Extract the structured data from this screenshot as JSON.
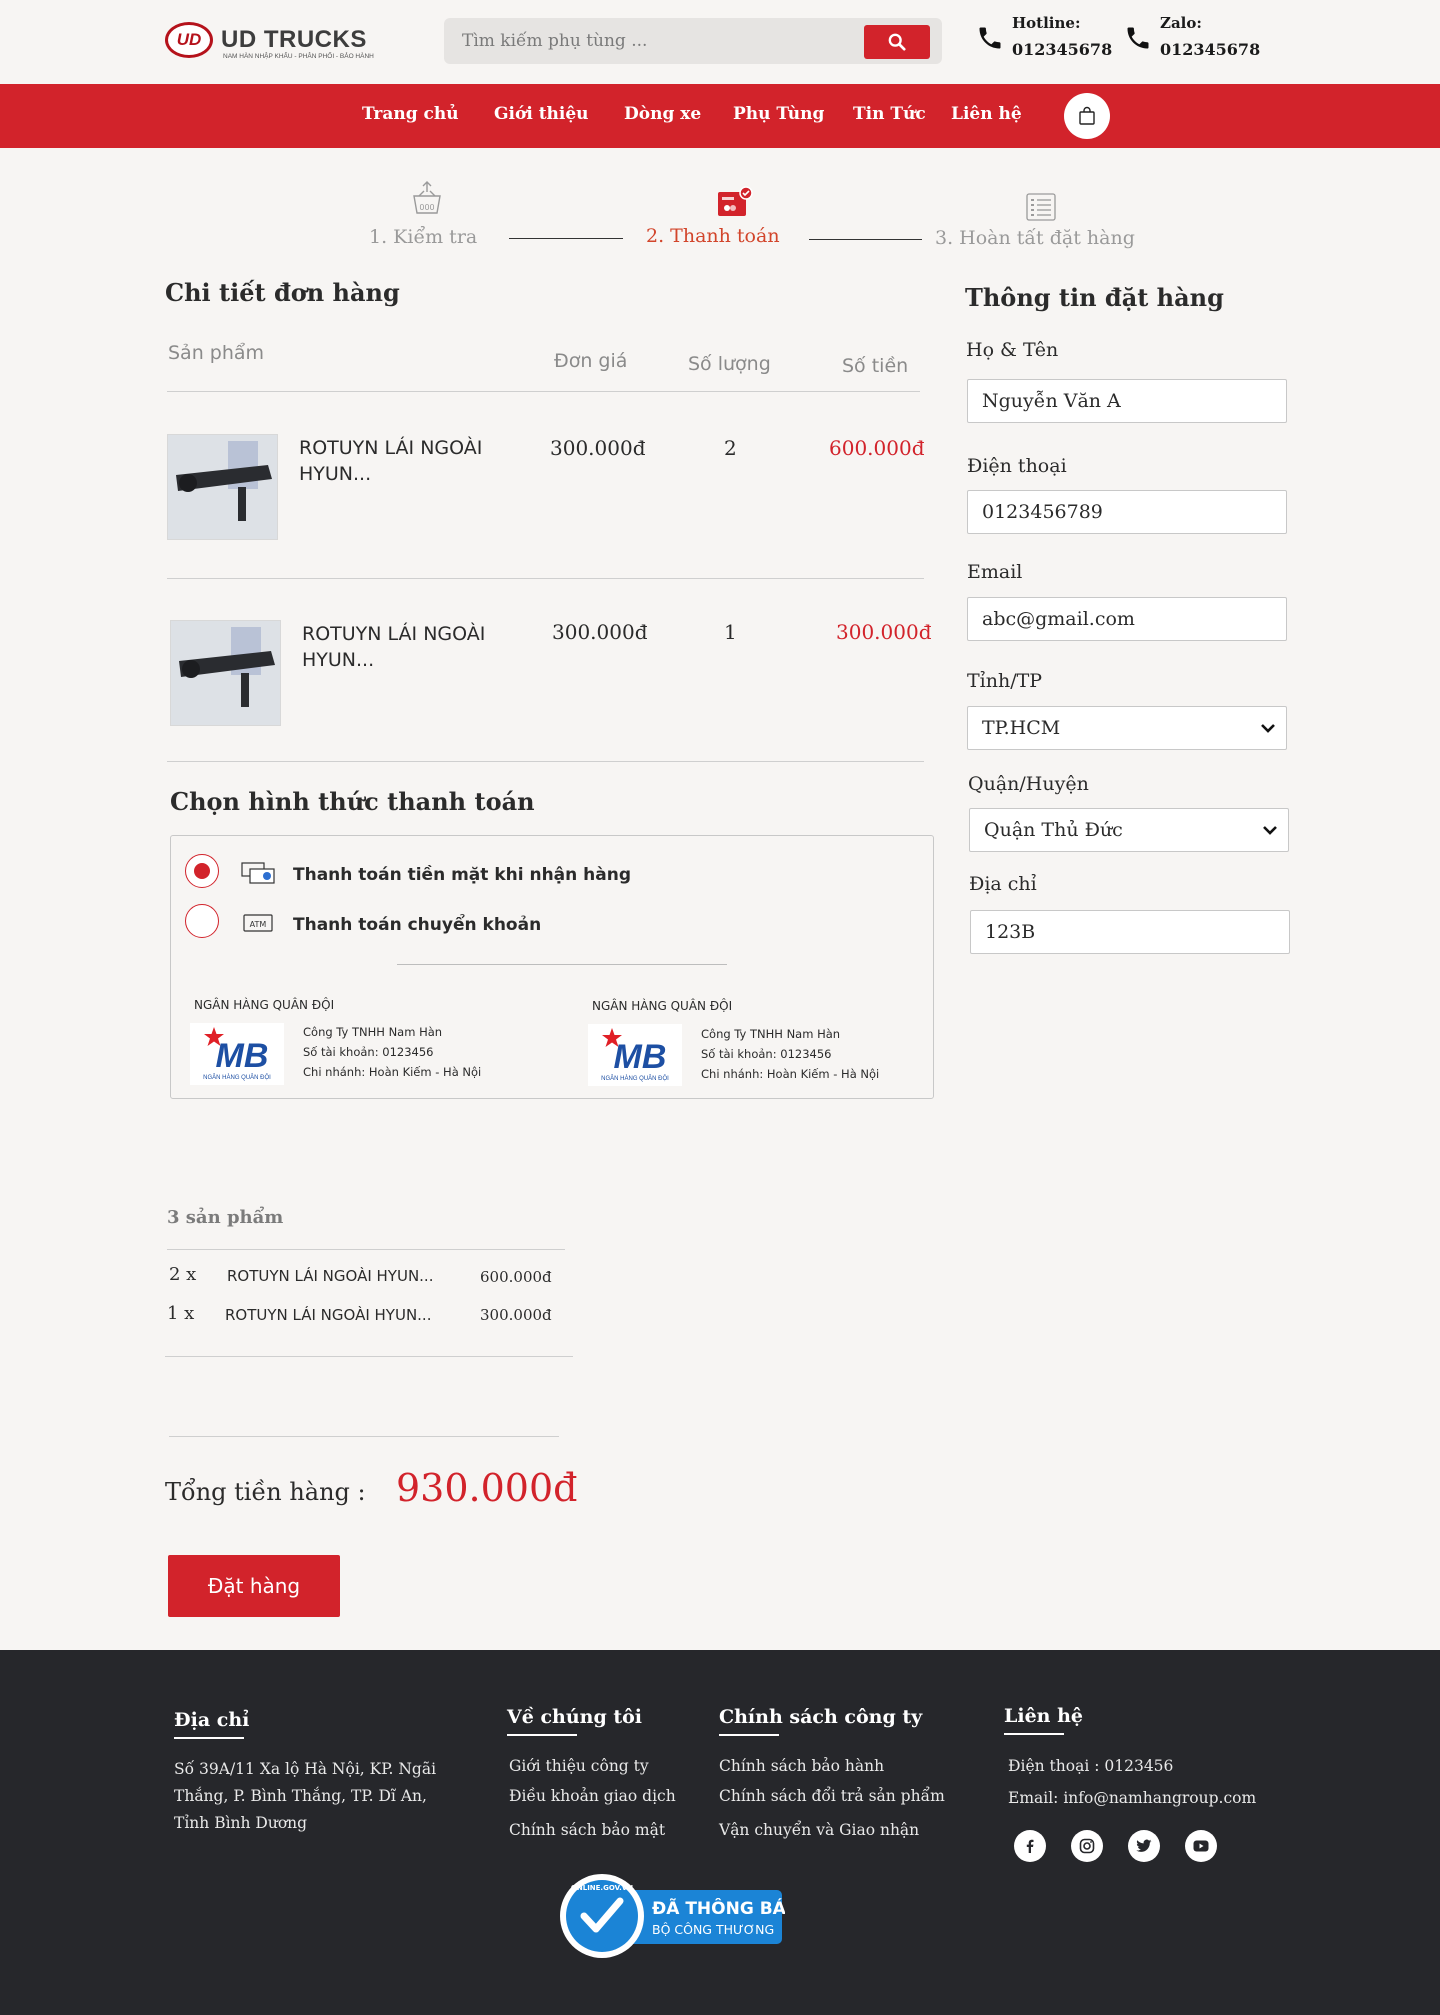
{
  "header": {
    "brand": "UD TRUCKS",
    "brand_badge": "UD",
    "brand_tagline": "NAM HÀN NHẬP KHẨU - PHÂN PHỐI - BẢO HÀNH",
    "search_placeholder": "Tìm kiếm phụ tùng ...",
    "hotline_label": "Hotline:",
    "hotline_value": "012345678",
    "zalo_label": "Zalo:",
    "zalo_value": "012345678"
  },
  "nav": {
    "items": [
      "Trang chủ",
      "Giới thiệu",
      "Dòng xe",
      "Phụ Tùng",
      "Tin Tức",
      "Liên hệ"
    ]
  },
  "steps": [
    {
      "label": "1. Kiểm tra",
      "icon": "basket-icon",
      "active": false
    },
    {
      "label": "2. Thanh toán",
      "icon": "wallet-check-icon",
      "active": true
    },
    {
      "label": "3. Hoàn tất đặt hàng",
      "icon": "checklist-icon",
      "active": false
    }
  ],
  "order": {
    "title": "Chi tiết đơn hàng",
    "columns": [
      "Sản phẩm",
      "Đơn giá",
      "Số lượng",
      "Số tiền"
    ],
    "rows": [
      {
        "name": "ROTUYN LÁI NGOÀI HYUN...",
        "unit_price": "300.000đ",
        "qty": "2",
        "total": "600.000đ"
      },
      {
        "name": "ROTUYN LÁI NGOÀI HYUN...",
        "unit_price": "300.000đ",
        "qty": "1",
        "total": "300.000đ"
      }
    ]
  },
  "payment": {
    "title": "Chọn hình thức thanh toán",
    "options": [
      {
        "label": "Thanh toán tiền mặt khi nhận hàng",
        "icon": "cash-icon",
        "selected": true
      },
      {
        "label": "Thanh toán chuyển khoản",
        "icon": "atm-card-icon",
        "selected": false
      }
    ],
    "banks": [
      {
        "bank": "NGÂN HÀNG QUÂN ĐỘI",
        "logo_text": "MB",
        "logo_sub": "NGÂN HÀNG QUÂN ĐỘI",
        "company": "Công Ty TNHH Nam Hàn",
        "account": "Số tài khoản: 0123456",
        "branch": "Chi nhánh: Hoàn Kiếm - Hà Nội"
      },
      {
        "bank": "NGÂN HÀNG QUÂN ĐỘI",
        "logo_text": "MB",
        "logo_sub": "NGÂN HÀNG QUÂN ĐỘI",
        "company": "Công Ty TNHH Nam Hàn",
        "account": "Số tài khoản: 0123456",
        "branch": "Chi nhánh: Hoàn Kiếm - Hà Nội"
      }
    ]
  },
  "summary": {
    "count_label": "3 sản phẩm",
    "lines": [
      {
        "qty": "2 x",
        "name": "ROTUYN LÁI NGOÀI HYUN...",
        "price": "600.000đ"
      },
      {
        "qty": "1 x",
        "name": "ROTUYN LÁI NGOÀI HYUN...",
        "price": "300.000đ"
      }
    ],
    "total_label": "Tổng tiền hàng :",
    "total_value": "930.000đ",
    "order_button": "Đặt hàng"
  },
  "form": {
    "title": "Thông tin đặt hàng",
    "name_label": "Họ & Tên",
    "name_value": "Nguyễn Văn A",
    "phone_label": "Điện thoại",
    "phone_value": "0123456789",
    "email_label": "Email",
    "email_value": "abc@gmail.com",
    "province_label": "Tỉnh/TP",
    "province_value": "TP.HCM",
    "district_label": "Quận/Huyện",
    "district_value": "Quận Thủ Đức",
    "address_label": "Địa chỉ",
    "address_value": "123B"
  },
  "footer": {
    "address_title": "Địa chỉ",
    "address_text": "Số 39A/11 Xa lộ Hà Nội, KP. Ngãi Thắng, P. Bình Thắng, TP. Dĩ An, Tỉnh Bình Dương",
    "about_title": "Về chúng tôi",
    "about_links": [
      "Giới thiệu công ty",
      "Điều khoản giao dịch",
      "Chính sách bảo mật"
    ],
    "policy_title": "Chính sách công ty",
    "policy_links": [
      "Chính sách bảo hành",
      "Chính sách đổi trả sản phẩm",
      "Vận chuyển và Giao nhận"
    ],
    "contact_title": "Liên hệ",
    "contact_phone": "Điện thoại : 0123456",
    "contact_email": "Email: info@namhangroup.com",
    "social_icons": [
      "facebook-icon",
      "instagram-icon",
      "twitter-icon",
      "youtube-icon"
    ],
    "badge_title": "ĐÃ THÔNG BÁO",
    "badge_sub": "BỘ CÔNG THƯƠNG",
    "badge_ring": "ONLINE.GOV.VN"
  },
  "colors": {
    "primary": "#d2232b",
    "background": "#f7f5f3",
    "footer": "#26272b"
  }
}
